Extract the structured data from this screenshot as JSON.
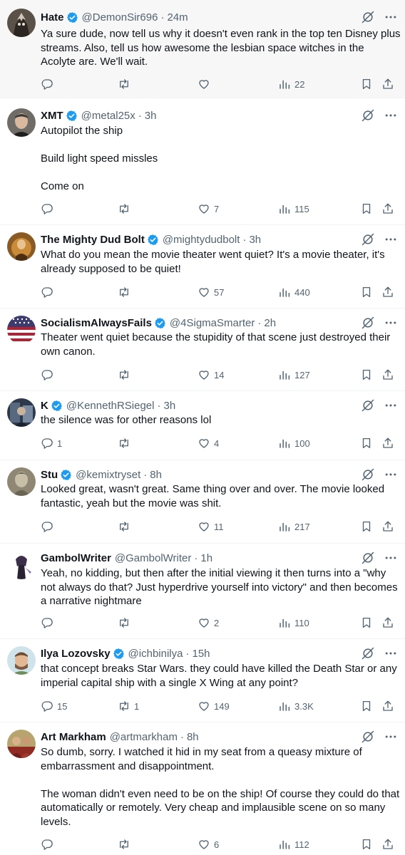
{
  "colors": {
    "accent": "#1d9bf0",
    "text": "#0f1419",
    "muted": "#536471",
    "divider": "#eff3f4"
  },
  "icons": {
    "verified": "verified-badge-icon",
    "grok": "grok-icon",
    "more": "more-icon",
    "reply": "reply-icon",
    "retweet": "retweet-icon",
    "like": "like-icon",
    "views": "views-icon",
    "bookmark": "bookmark-icon",
    "share": "share-icon"
  },
  "tweets": [
    {
      "name": "Hate",
      "verified": true,
      "handle": "@DemonSir696",
      "time": "24m",
      "text": "Ya sure dude, now tell us why it doesn't even rank in the top ten Disney plus streams. Also, tell us how awesome the lesbian space witches in the Acolyte are. We'll wait.",
      "replies": "",
      "retweets": "",
      "likes": "",
      "views": "22"
    },
    {
      "name": "XMT",
      "verified": true,
      "handle": "@metal25x",
      "time": "3h",
      "text": "Autopilot the ship\n\nBuild light speed missles\n\nCome on",
      "replies": "",
      "retweets": "",
      "likes": "7",
      "views": "115"
    },
    {
      "name": "The Mighty Dud Bolt",
      "verified": true,
      "handle": "@mightydudbolt",
      "time": "3h",
      "text": "What do you mean the movie theater went quiet? It's a movie theater, it's already supposed to be quiet!",
      "replies": "",
      "retweets": "",
      "likes": "57",
      "views": "440"
    },
    {
      "name": "SocialismAlwaysFails",
      "verified": true,
      "handle": "@4SigmaSmarter",
      "time": "2h",
      "text": "Theater went quiet because the stupidity of that scene just destroyed their own canon.",
      "replies": "",
      "retweets": "",
      "likes": "14",
      "views": "127"
    },
    {
      "name": "K",
      "verified": true,
      "handle": "@KennethRSiegel",
      "time": "3h",
      "text": "the silence was for other reasons lol",
      "replies": "1",
      "retweets": "",
      "likes": "4",
      "views": "100"
    },
    {
      "name": "Stu",
      "verified": true,
      "handle": "@kemixtryset",
      "time": "8h",
      "text": "Looked great, wasn't great. Same thing over and over. The movie looked fantastic, yeah but the movie was shit.",
      "replies": "",
      "retweets": "",
      "likes": "11",
      "views": "217"
    },
    {
      "name": "GambolWriter",
      "verified": false,
      "handle": "@GambolWriter",
      "time": "1h",
      "text": "Yeah, no kidding, but then after the initial viewing it then turns into a \"why not always do that? Just hyperdrive yourself into victory\" and then becomes a narrative nightmare",
      "replies": "",
      "retweets": "",
      "likes": "2",
      "views": "110"
    },
    {
      "name": "Ilya Lozovsky",
      "verified": true,
      "handle": "@ichbinilya",
      "time": "15h",
      "text": "that concept breaks Star Wars. they could have killed the Death Star or any imperial capital ship with a single X Wing at any point?",
      "replies": "15",
      "retweets": "1",
      "likes": "149",
      "views": "3.3K"
    },
    {
      "name": "Art Markham",
      "verified": false,
      "handle": "@artmarkham",
      "time": "8h",
      "text": "So dumb, sorry. I watched it hid in my seat from a queasy mixture of embarrassment and disappointment.\n\nThe woman didn't even need to be on the ship! Of course they could do that automatically or remotely. Very cheap and implausible scene on so many levels.",
      "replies": "",
      "retweets": "",
      "likes": "6",
      "views": "112"
    }
  ]
}
